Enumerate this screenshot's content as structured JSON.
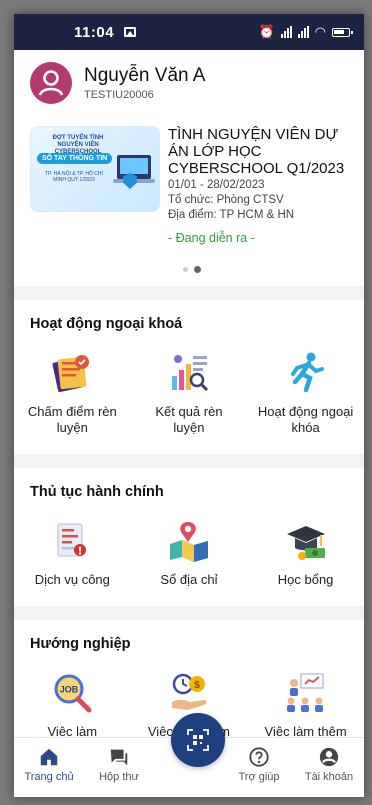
{
  "status_bar": {
    "time": "11:04"
  },
  "user": {
    "name": "Nguyễn Văn A",
    "id": "TESTIU20006"
  },
  "event": {
    "banner_line1": "ĐỢT TUYỂN TÌNH NGUYỆN VIÊN CYBERSCHOOL",
    "banner_line2": "SỔ TAY THÔNG TIN",
    "banner_line3": "TP. HÀ NỘI & TP. HỒ CHÍ MINH QUÝ 1/2023",
    "title": "TÌNH NGUYỆN VIÊN DỰ ÁN LỚP HỌC CYBERSCHOOL Q1/2023",
    "dates": "01/01 - 28/02/2023",
    "organizer": "Tổ chức: Phòng CTSV",
    "location": "Địa điểm: TP HCM & HN",
    "status": "- Đang diễn ra -"
  },
  "sections": [
    {
      "title": "Hoạt động ngoại khoá",
      "items": [
        {
          "label": "Chấm điểm rèn luyện",
          "icon": "score-icon"
        },
        {
          "label": "Kết quả rèn luyện",
          "icon": "results-icon"
        },
        {
          "label": "Hoạt động ngoại khóa",
          "icon": "running-icon"
        }
      ]
    },
    {
      "title": "Thủ tục hành chính",
      "items": [
        {
          "label": "Dịch vụ công",
          "icon": "public-service-icon"
        },
        {
          "label": "Sổ địa chỉ",
          "icon": "address-book-icon"
        },
        {
          "label": "Học bổng",
          "icon": "scholarship-icon"
        }
      ]
    },
    {
      "title": "Hướng nghiệp",
      "items": [
        {
          "label": "Việc làm",
          "icon": "job-icon"
        },
        {
          "label": "Việc làm thêm",
          "icon": "part-time-icon"
        },
        {
          "label": "Việc làm thêm",
          "icon": "recruitment-icon"
        }
      ]
    }
  ],
  "bottom_nav": [
    {
      "label": "Trang chủ",
      "icon": "home-icon"
    },
    {
      "label": "Hộp thư",
      "icon": "inbox-icon"
    },
    {
      "label": "Trợ giúp",
      "icon": "help-icon"
    },
    {
      "label": "Tài khoản",
      "icon": "account-icon"
    }
  ],
  "colors": {
    "accent": "#1e3f80",
    "status_bar": "#1c2340",
    "ongoing": "#2e9e3a"
  }
}
